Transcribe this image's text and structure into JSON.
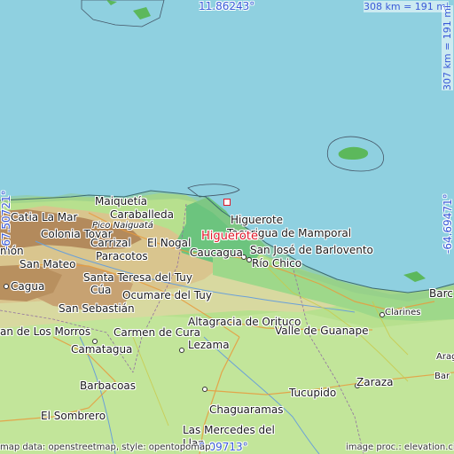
{
  "map": {
    "coords": {
      "top": "11.86243°",
      "bottom": "9.09713°",
      "left": "-67.50721°",
      "right": "-64.69471°"
    },
    "scale": {
      "horizontal": "308 km = 191 mi",
      "vertical": "307 km = 191 mi"
    },
    "credits": {
      "left": "map data: openstreetmap, style: opentopomap",
      "right": "image proc.: elevation.city"
    },
    "highlight": "Higuerote",
    "places": {
      "maiquetia": "Maiquetía",
      "catia_la_mar": "Catia La Mar",
      "caraballeda": "Caraballeda",
      "higuerote": "Higuerote",
      "tacarigua": "Tacarigua de Mamporal",
      "pico_naiguata": "Pico Naiguatá",
      "colonia_tovar": "Colonia Tovar",
      "carrizal": "Carrizal",
      "el_nogal": "El Nogal",
      "caucagua": "Caucagua",
      "san_jose": "San José de Barlovento",
      "rio_chico": "Río Chico",
      "paracotos": "Paracotos",
      "san_mateo": "San Mateo",
      "santa_teresa": "Santa Teresa del Tuy",
      "cagua": "Cagua",
      "cua": "Cúa",
      "ocumare": "Ocumare del Tuy",
      "san_sebastian": "San Sebastián",
      "altagracia": "Altagracia de Orituco",
      "valle_guanape": "Valle de Guanape",
      "clarines": "Clarines",
      "barcelona": "Barc",
      "los_morros": "an de Los Morros",
      "carmen_cura": "Carmen de Cura",
      "camatagua": "Camatagua",
      "lezama": "Lezama",
      "barbacoas": "Barbacoas",
      "el_sombrero": "El Sombrero",
      "chaguaramas": "Chaguaramas",
      "tucupido": "Tucupido",
      "zaraza": "Zaraza",
      "las_mercedes": "Las Mercedes del",
      "llano": "Llan",
      "aragua": "Arag",
      "barcel": "Bar",
      "mon": "món"
    }
  }
}
